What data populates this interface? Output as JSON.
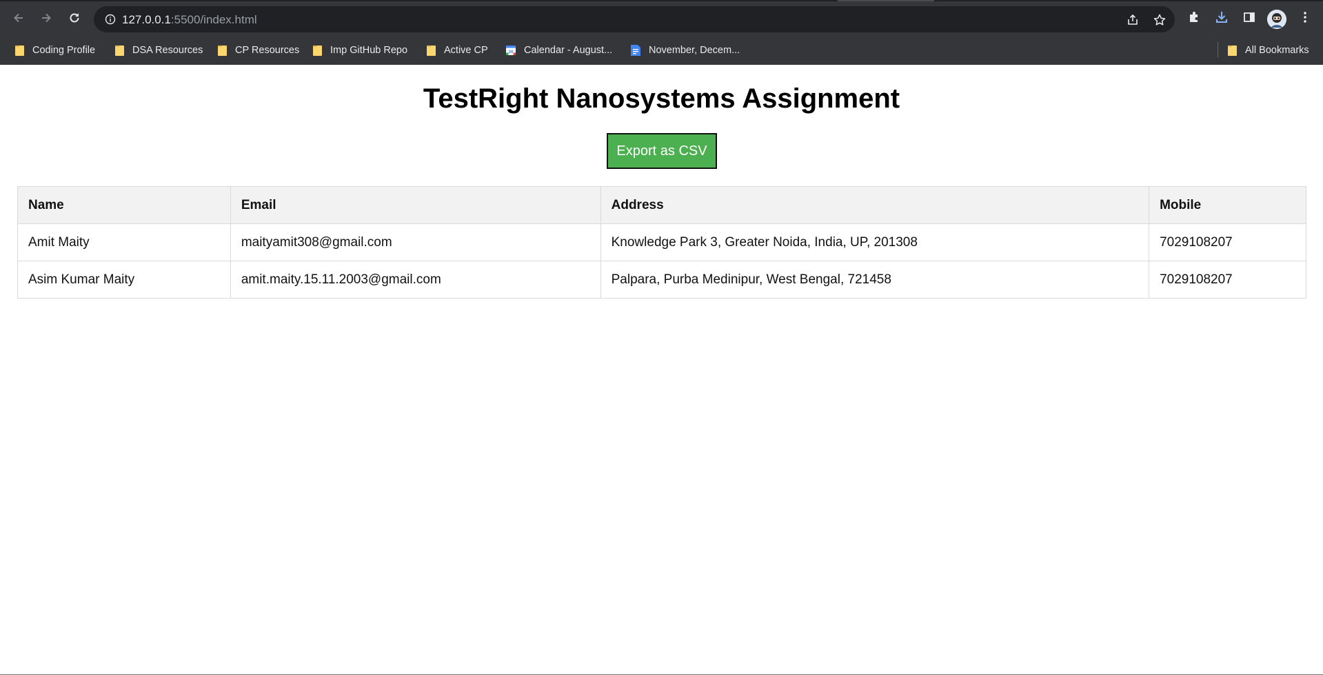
{
  "browser": {
    "url_host": "127.0.0.1",
    "url_path": ":5500/index.html",
    "bookmarks": [
      {
        "label": "Coding Profile",
        "icon": "folder-icon"
      },
      {
        "label": "DSA Resources",
        "icon": "folder-icon"
      },
      {
        "label": "CP Resources",
        "icon": "folder-icon"
      },
      {
        "label": "Imp GitHub Repo",
        "icon": "folder-icon"
      },
      {
        "label": "Active CP",
        "icon": "folder-icon"
      },
      {
        "label": "Calendar - August...",
        "icon": "calendar-icon"
      },
      {
        "label": "November, Decem...",
        "icon": "docs-icon"
      }
    ],
    "all_bookmarks": "All Bookmarks"
  },
  "page": {
    "title": "TestRight Nanosystems Assignment",
    "export_label": "Export as CSV"
  },
  "table": {
    "headers": [
      "Name",
      "Email",
      "Address",
      "Mobile"
    ],
    "rows": [
      [
        "Amit Maity",
        "maityamit308@gmail.com",
        "Knowledge Park 3, Greater Noida, India, UP, 201308",
        "7029108207"
      ],
      [
        "Asim Kumar Maity",
        "amit.maity.15.11.2003@gmail.com",
        "Palpara, Purba Medinipur, West Bengal, 721458",
        "7029108207"
      ]
    ]
  },
  "colors": {
    "chrome_bg": "#35363a",
    "omnibox_bg": "#202124",
    "export_button": "#4caf50",
    "table_header_bg": "#f2f2f2"
  }
}
